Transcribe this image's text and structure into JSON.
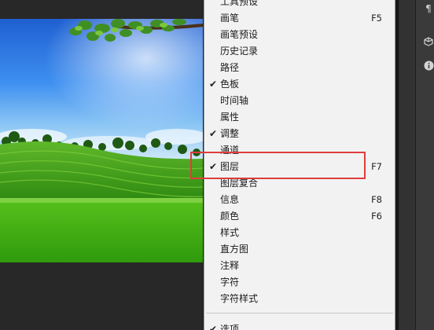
{
  "colors": {
    "menu_bg": "#f2f2f2",
    "highlight_border": "#e03c3c",
    "app_bg": "#262626"
  },
  "photo": {
    "watermark": ""
  },
  "window_menu": {
    "items": [
      {
        "label": "工具预设",
        "shortcut": "",
        "checked": false
      },
      {
        "label": "画笔",
        "shortcut": "F5",
        "checked": false
      },
      {
        "label": "画笔预设",
        "shortcut": "",
        "checked": false
      },
      {
        "label": "历史记录",
        "shortcut": "",
        "checked": false
      },
      {
        "label": "路径",
        "shortcut": "",
        "checked": false
      },
      {
        "label": "色板",
        "shortcut": "",
        "checked": true
      },
      {
        "label": "时间轴",
        "shortcut": "",
        "checked": false
      },
      {
        "label": "属性",
        "shortcut": "",
        "checked": false
      },
      {
        "label": "调整",
        "shortcut": "",
        "checked": true
      },
      {
        "label": "通道",
        "shortcut": "",
        "checked": false
      },
      {
        "label": "图层",
        "shortcut": "F7",
        "checked": true
      },
      {
        "label": "图层复合",
        "shortcut": "",
        "checked": false
      },
      {
        "label": "信息",
        "shortcut": "F8",
        "checked": false
      },
      {
        "label": "颜色",
        "shortcut": "F6",
        "checked": false
      },
      {
        "label": "样式",
        "shortcut": "",
        "checked": false
      },
      {
        "label": "直方图",
        "shortcut": "",
        "checked": false
      },
      {
        "label": "注释",
        "shortcut": "",
        "checked": false
      },
      {
        "label": "字符",
        "shortcut": "",
        "checked": false
      },
      {
        "label": "字符样式",
        "shortcut": "",
        "checked": false
      },
      {
        "label": "选项",
        "shortcut": "",
        "checked": true
      }
    ],
    "check_glyph": "✔"
  },
  "right_panel": {
    "icons": [
      "paragraph-icon",
      "3d-cube-icon",
      "info-icon"
    ]
  }
}
